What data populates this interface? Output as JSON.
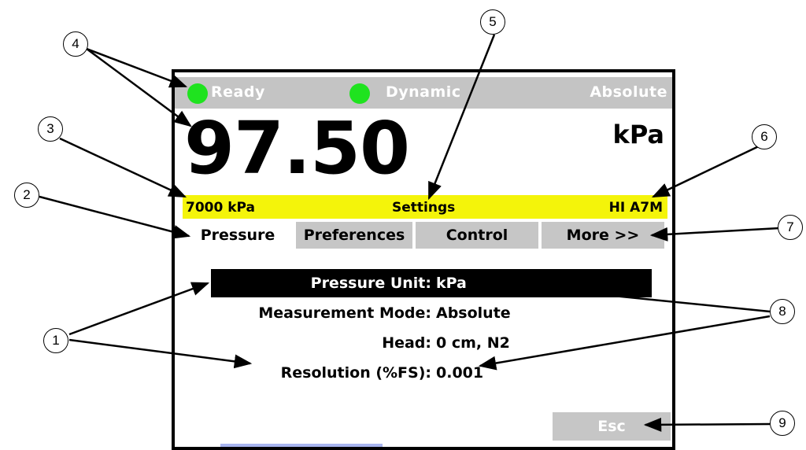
{
  "status": {
    "ready_label": "Ready",
    "mode_label": "Dynamic",
    "reference_label": "Absolute",
    "led_color": "#1fe31f"
  },
  "reading": {
    "value": "97.50",
    "unit": "kPa"
  },
  "info_bar": {
    "range": "7000 kPa",
    "title": "Settings",
    "sensor": "HI A7M",
    "color": "#f4f40a"
  },
  "tabs": [
    {
      "label": "Pressure",
      "active": true
    },
    {
      "label": "Preferences",
      "active": false
    },
    {
      "label": "Control",
      "active": false
    },
    {
      "label": "More >>",
      "active": false
    }
  ],
  "settings": [
    {
      "label": "Pressure Unit:",
      "value": "kPa",
      "selected": true
    },
    {
      "label": "Measurement Mode:",
      "value": "Absolute",
      "selected": false
    },
    {
      "label": "Head:",
      "value": "0 cm, N2",
      "selected": false
    },
    {
      "label": "Resolution (%FS):",
      "value": "0.001",
      "selected": false
    }
  ],
  "esc_label": "Esc",
  "callouts": [
    "1",
    "2",
    "3",
    "4",
    "5",
    "6",
    "7",
    "8",
    "9"
  ]
}
